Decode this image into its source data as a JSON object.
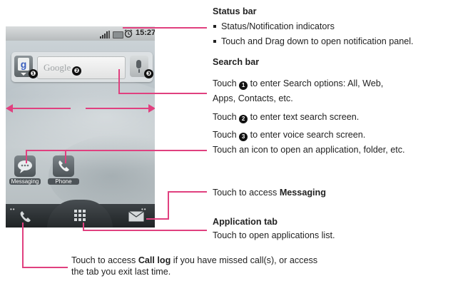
{
  "phone": {
    "clock": "15:27",
    "search_logo": "Google",
    "google_button_glyph": "g",
    "number_markers": [
      "❶",
      "❷",
      "❸"
    ],
    "apps": [
      {
        "label": "Messaging",
        "icon": "messaging-icon"
      },
      {
        "label": "Phone",
        "icon": "phone-icon"
      }
    ],
    "dock": {
      "left_icon": "call-log-icon",
      "center_icon": "app-grid-icon",
      "right_icon": "envelope-icon"
    },
    "swipe_arrow_color": "#e0407f"
  },
  "callouts": {
    "status_bar": {
      "heading": "Status bar",
      "bullets": [
        "Status/Notification indicators",
        "Touch and Drag down to open notification panel."
      ]
    },
    "search_bar": {
      "heading": "Search bar",
      "line1_pre": "Touch ",
      "num1": "1",
      "line1_post": " to enter Search options: All, Web,",
      "line1b": "Apps, Contacts, etc.",
      "line2_pre": "Touch ",
      "num2": "2",
      "line2_post": " to enter text search screen.",
      "line3_pre": "Touch ",
      "num3": "3",
      "line3_post": " to enter voice search screen."
    },
    "icon_hint": "Touch an icon to open an application, folder, etc.",
    "messaging_hint": {
      "pre": "Touch to access ",
      "bold": "Messaging"
    },
    "application_tab": {
      "heading": "Application tab",
      "text": "Touch to open applications list."
    },
    "call_log": {
      "pre": "Touch to access ",
      "bold": "Call log",
      "post": " if you have missed call(s), or access",
      "line2": "the tab you exit last time."
    }
  },
  "accent_color": "#e0407f"
}
